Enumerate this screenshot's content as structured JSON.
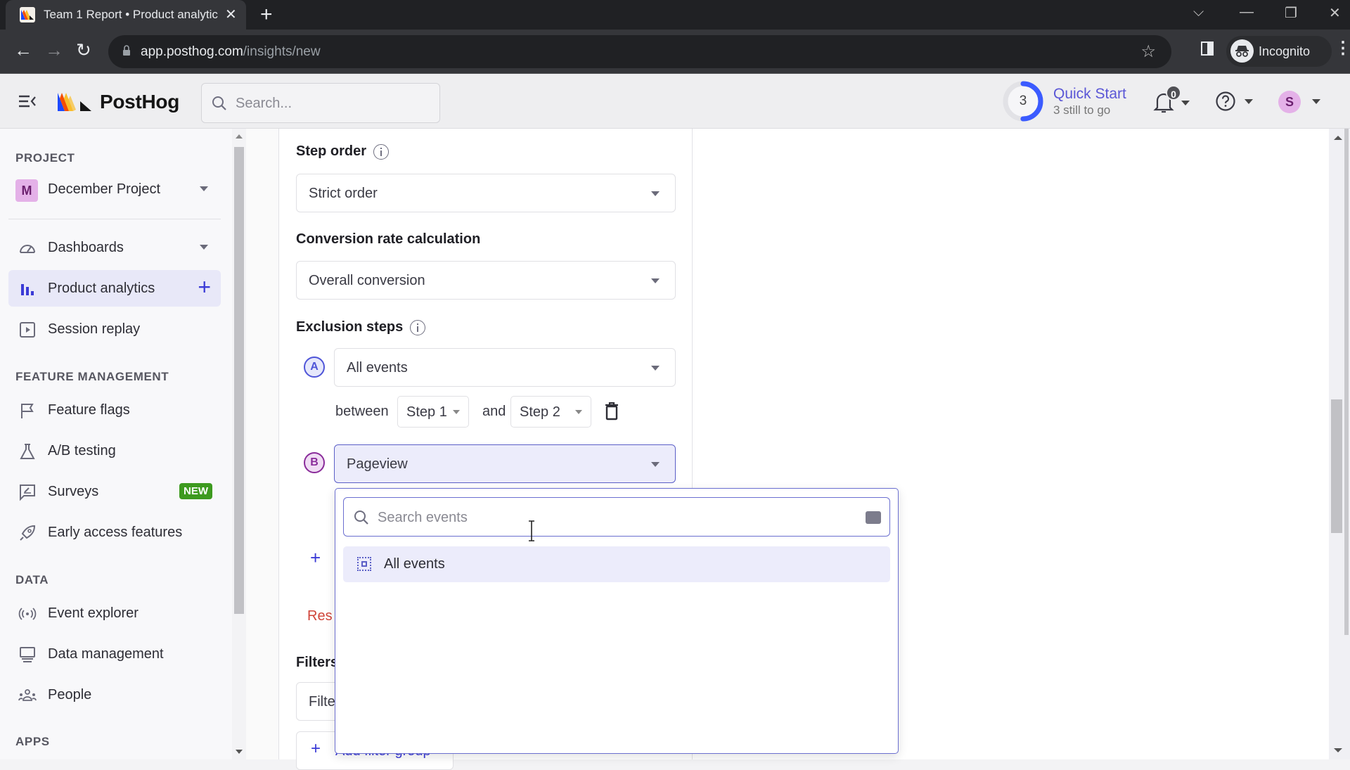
{
  "browser": {
    "tab_title": "Team 1 Report • Product analytic",
    "url_host": "app.posthog.com",
    "url_path": "/insights/new",
    "profile_label": "Incognito"
  },
  "header": {
    "brand": "PostHog",
    "search_placeholder": "Search...",
    "quick_start": {
      "title": "Quick Start",
      "subtitle": "3 still to go",
      "remaining": "3",
      "progress_fraction": 0.5
    },
    "notifications_count": "0",
    "user_initial": "S"
  },
  "sidebar": {
    "project_section": "PROJECT",
    "project": {
      "initial": "M",
      "name": "December Project"
    },
    "items_main": [
      {
        "label": "Dashboards",
        "icon": "gauge-icon"
      },
      {
        "label": "Product analytics",
        "icon": "bar-chart-icon",
        "active": true
      },
      {
        "label": "Session replay",
        "icon": "play-square-icon"
      }
    ],
    "feature_section": "FEATURE MANAGEMENT",
    "items_feature": [
      {
        "label": "Feature flags",
        "icon": "flag-icon"
      },
      {
        "label": "A/B testing",
        "icon": "flask-icon"
      },
      {
        "label": "Surveys",
        "icon": "survey-icon",
        "badge": "NEW"
      },
      {
        "label": "Early access features",
        "icon": "rocket-icon"
      }
    ],
    "data_section": "DATA",
    "items_data": [
      {
        "label": "Event explorer",
        "icon": "broadcast-icon"
      },
      {
        "label": "Data management",
        "icon": "database-icon"
      },
      {
        "label": "People",
        "icon": "people-icon"
      }
    ],
    "apps_section": "APPS"
  },
  "panel": {
    "step_order_label": "Step order",
    "step_order_value": "Strict order",
    "conversion_label": "Conversion rate calculation",
    "conversion_value": "Overall conversion",
    "exclusion_label": "Exclusion steps",
    "exclusions": [
      {
        "letter": "A",
        "event": "All events",
        "between": "between",
        "from": "Step 1",
        "and": "and",
        "to": "Step 2"
      },
      {
        "letter": "B",
        "event": "Pageview"
      }
    ],
    "reset_partial": "Res",
    "filters_partial": "Filters",
    "filter_input_partial": "Filte",
    "add_filter_group_partial": "Add filter group"
  },
  "dropdown": {
    "search_placeholder": "Search events",
    "options": [
      {
        "label": "All events",
        "highlighted": true
      }
    ]
  },
  "colors": {
    "accent": "#5a56d6",
    "new_badge": "#3d9a1f",
    "reset_red": "#d0453a",
    "step_a": "#4f55d8",
    "step_b": "#8a2c9a"
  }
}
